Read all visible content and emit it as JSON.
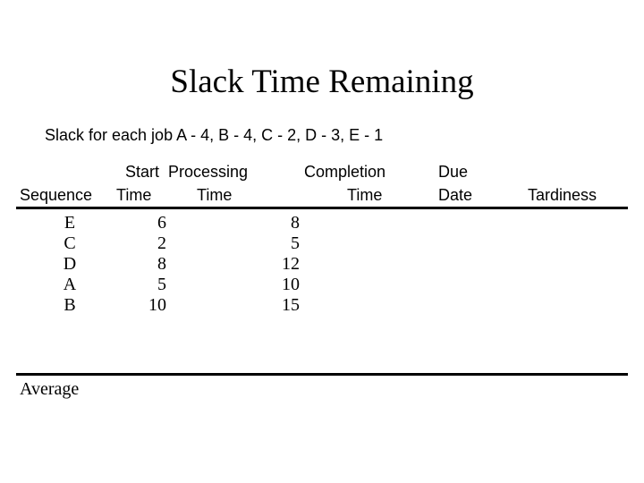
{
  "slide": {
    "title": "Slack Time Remaining",
    "subtitle": "Slack for each job A - 4, B - 4, C - 2, D - 3, E - 1"
  },
  "table": {
    "header_line1": {
      "start": "Start",
      "processing": "Processing",
      "completion": "Completion",
      "due": "Due"
    },
    "header_line2": {
      "sequence": "Sequence",
      "time_start": "Time",
      "time_processing": "Time",
      "time_completion": "Time",
      "date_due": "Date",
      "tardiness": "Tardiness"
    },
    "rows": [
      {
        "sequence": "E",
        "start_time": "6",
        "processing_time": "",
        "completion_time": "8",
        "due_date": "",
        "tardiness": ""
      },
      {
        "sequence": "C",
        "start_time": "2",
        "processing_time": "",
        "completion_time": "5",
        "due_date": "",
        "tardiness": ""
      },
      {
        "sequence": "D",
        "start_time": "8",
        "processing_time": "",
        "completion_time": "12",
        "due_date": "",
        "tardiness": ""
      },
      {
        "sequence": "A",
        "start_time": "5",
        "processing_time": "",
        "completion_time": "10",
        "due_date": "",
        "tardiness": ""
      },
      {
        "sequence": "B",
        "start_time": "10",
        "processing_time": "",
        "completion_time": "15",
        "due_date": "",
        "tardiness": ""
      }
    ],
    "average_label": "Average",
    "average_values": {
      "start_time": "",
      "processing_time": "",
      "completion_time": "",
      "due_date": "",
      "tardiness": ""
    }
  },
  "colors": {
    "background": "#ffffff",
    "text": "#000000",
    "rule": "#000000"
  }
}
